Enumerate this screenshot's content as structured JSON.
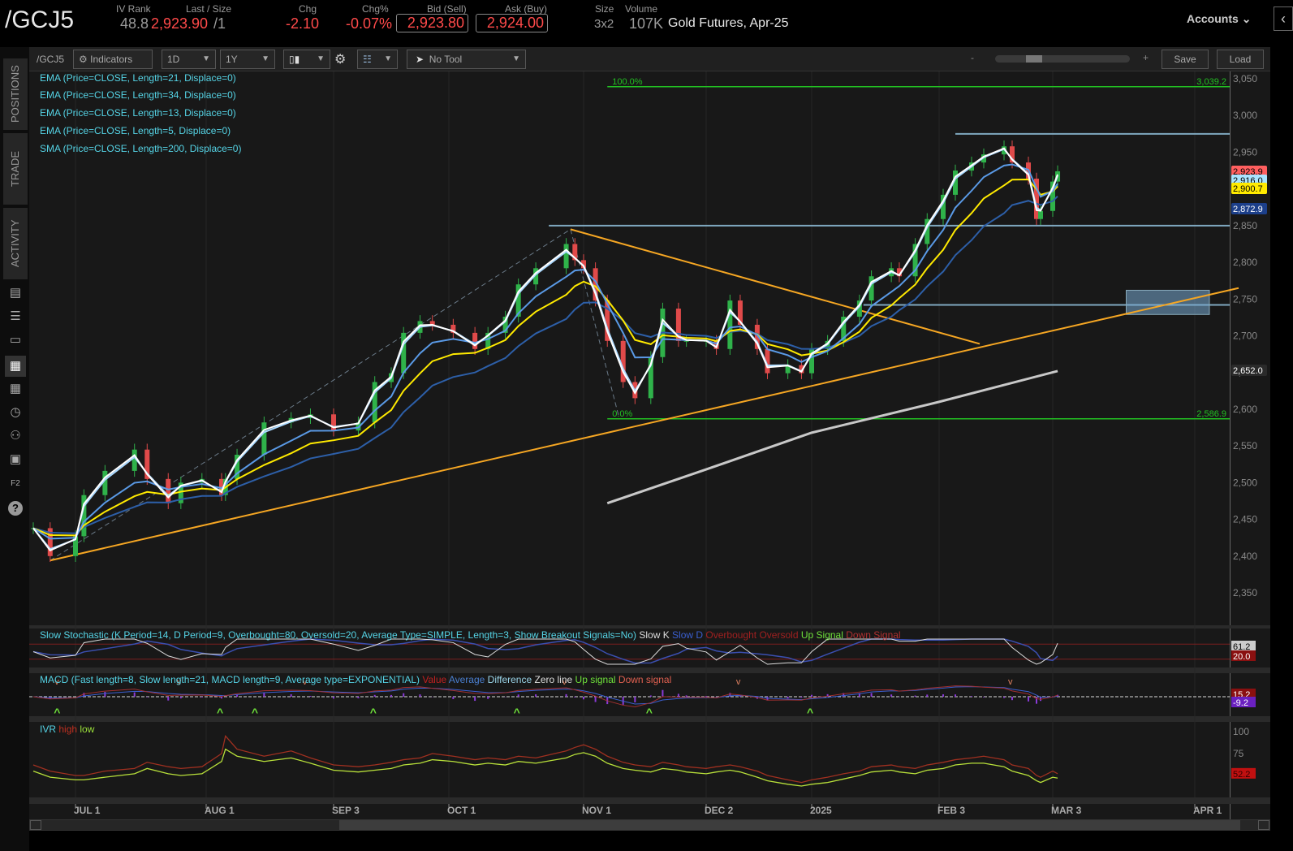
{
  "header": {
    "symbol": "/GCJ5",
    "iv_rank_label": "IV Rank",
    "iv_rank": "48.8",
    "last_label": "Last / Size",
    "last": "2,923.90",
    "size": "/1",
    "chg_label": "Chg",
    "chg": "-2.10",
    "chgpct_label": "Chg%",
    "chgpct": "-0.07%",
    "bid_label": "Bid (Sell)",
    "bid": "2,923.80",
    "ask_label": "Ask (Buy)",
    "ask": "2,924.00",
    "size_label": "Size",
    "size_val": "3x2",
    "volume_label": "Volume",
    "volume": "107K",
    "description": "Gold Futures, Apr-25",
    "accounts": "Accounts"
  },
  "toolbar": {
    "symbol": "/GCJ5",
    "indicators": "Indicators",
    "aggregation": "1D",
    "timeframe": "1Y",
    "tool": "No Tool",
    "zoom_minus": "-",
    "zoom_plus": "+",
    "save": "Save",
    "load": "Load"
  },
  "sidebar": {
    "tabs": [
      "POSITIONS",
      "TRADE",
      "ACTIVITY"
    ],
    "icons": [
      "news-icon",
      "list-icon",
      "tv-icon",
      "chart-icon",
      "grid-icon",
      "clock-icon",
      "people-icon",
      "calendar-icon",
      "function-key-icon",
      "help-icon"
    ]
  },
  "studies": [
    "EMA (Price=CLOSE, Length=21, Displace=0)",
    "EMA (Price=CLOSE, Length=34, Displace=0)",
    "EMA (Price=CLOSE, Length=13, Displace=0)",
    "EMA (Price=CLOSE, Length=5, Displace=0)",
    "SMA (Price=CLOSE, Length=200, Displace=0)"
  ],
  "stoch": {
    "label": "Slow Stochastic (K Period=14, D Period=9, Overbought=80, Oversold=20, Average Type=SIMPLE, Length=3, Show Breakout Signals=No)",
    "legend": [
      "Slow K",
      "Slow D",
      "Overbought",
      "Oversold",
      "Up Signal",
      "Down Signal"
    ],
    "badges": [
      "61.2",
      "20.0"
    ]
  },
  "macd": {
    "label": "MACD (Fast length=8, Slow length=21, MACD length=9, Average type=EXPONENTIAL)",
    "legend": [
      "Value",
      "Average",
      "Difference",
      "Zero line",
      "Up signal",
      "Down signal"
    ],
    "badges": [
      "15.2",
      "-9.2"
    ],
    "up_signal_dates": [
      "2024-06-27",
      "2024-08-05",
      "2024-08-14",
      "2024-09-13",
      "2024-10-17",
      "2024-11-18",
      "2025-01-02"
    ],
    "down_signal_dates": [
      "2024-06-27",
      "2024-07-26",
      "2024-08-27",
      "2024-10-28",
      "2024-12-12",
      "2025-02-21"
    ]
  },
  "ivr": {
    "label": "IVR",
    "legend": [
      "high",
      "low"
    ],
    "ticks": [
      100,
      75
    ],
    "badge": "52.2"
  },
  "colors": {
    "up": "#2fb24a",
    "down": "#e04a4a",
    "ema5": "#ffffff",
    "ema13": "#a9d8ff",
    "ema21": "#5a9ae6",
    "ema34": "#ffea00",
    "ema34b": "#2d5fa8",
    "sma200": "#c8c8c8",
    "trend": "#f5a623",
    "fib": "#22c022",
    "level": "#7fa8bf"
  },
  "chart_data": {
    "type": "candlestick",
    "symbol": "/GCJ5",
    "ylim": [
      2300,
      3075
    ],
    "yticks": [
      2350,
      2400,
      2450,
      2500,
      2550,
      2600,
      2650,
      2700,
      2750,
      2800,
      2850,
      2900,
      2950,
      3000,
      3050
    ],
    "ytick_labels": [
      "2,350",
      "2,400",
      "2,450",
      "2,500",
      "2,550",
      "2,600",
      "2,650",
      "2,700",
      "2,750",
      "2,800",
      "2,850",
      "2,900",
      "2,950",
      "3,000",
      "3,050"
    ],
    "xticks": [
      {
        "date": "2024-07-01",
        "label": "JUL 1"
      },
      {
        "date": "2024-08-01",
        "label": "AUG 1"
      },
      {
        "date": "2024-09-03",
        "label": "SEP 3"
      },
      {
        "date": "2024-10-01",
        "label": "OCT 1"
      },
      {
        "date": "2024-11-01",
        "label": "NOV 1"
      },
      {
        "date": "2024-12-02",
        "label": "DEC 2"
      },
      {
        "date": "2025-01-02",
        "label": "2025"
      },
      {
        "date": "2025-02-03",
        "label": "FEB 3"
      },
      {
        "date": "2025-03-03",
        "label": "MAR 3"
      },
      {
        "date": "2025-04-01",
        "label": "APR 1"
      }
    ],
    "dates": [
      "2024-06-21",
      "2024-06-25",
      "2024-07-01",
      "2024-07-03",
      "2024-07-08",
      "2024-07-15",
      "2024-07-18",
      "2024-07-23",
      "2024-07-26",
      "2024-07-31",
      "2024-08-05",
      "2024-08-06",
      "2024-08-09",
      "2024-08-16",
      "2024-08-23",
      "2024-08-28",
      "2024-09-03",
      "2024-09-09",
      "2024-09-13",
      "2024-09-17",
      "2024-09-20",
      "2024-09-24",
      "2024-09-27",
      "2024-10-02",
      "2024-10-07",
      "2024-10-10",
      "2024-10-14",
      "2024-10-17",
      "2024-10-21",
      "2024-10-28",
      "2024-10-30",
      "2024-11-01",
      "2024-11-04",
      "2024-11-07",
      "2024-11-11",
      "2024-11-14",
      "2024-11-18",
      "2024-11-21",
      "2024-11-25",
      "2024-11-27",
      "2024-12-02",
      "2024-12-05",
      "2024-12-09",
      "2024-12-12",
      "2024-12-17",
      "2024-12-20",
      "2024-12-26",
      "2024-12-30",
      "2025-01-02",
      "2025-01-06",
      "2025-01-10",
      "2025-01-14",
      "2025-01-17",
      "2025-01-22",
      "2025-01-24",
      "2025-01-28",
      "2025-01-31",
      "2025-02-04",
      "2025-02-07",
      "2025-02-11",
      "2025-02-14",
      "2025-02-19",
      "2025-02-21",
      "2025-02-25",
      "2025-02-27",
      "2025-02-28",
      "2025-03-03",
      "2025-03-04"
    ],
    "close": [
      2438,
      2400,
      2427,
      2483,
      2516,
      2545,
      2505,
      2472,
      2500,
      2505,
      2483,
      2505,
      2538,
      2582,
      2588,
      2593,
      2571,
      2582,
      2637,
      2649,
      2704,
      2720,
      2715,
      2704,
      2682,
      2704,
      2726,
      2770,
      2792,
      2825,
      2803,
      2792,
      2748,
      2693,
      2637,
      2615,
      2671,
      2737,
      2693,
      2693,
      2693,
      2682,
      2748,
      2715,
      2682,
      2649,
      2660,
      2649,
      2682,
      2693,
      2726,
      2748,
      2781,
      2792,
      2781,
      2825,
      2859,
      2892,
      2925,
      2936,
      2947,
      2958,
      2936,
      2914,
      2859,
      2870,
      2910,
      2924
    ],
    "sma200": [
      {
        "date": "2024-11-07",
        "value": 2472
      },
      {
        "date": "2024-12-02",
        "value": 2518
      },
      {
        "date": "2025-01-02",
        "value": 2568
      },
      {
        "date": "2025-02-03",
        "value": 2610
      },
      {
        "date": "2025-03-04",
        "value": 2652
      }
    ],
    "price_badges": [
      {
        "label": "2,923.9",
        "color": "#ff5f5f"
      },
      {
        "label": "2,916.0",
        "color": "#a9e4ff"
      },
      {
        "label": "2,900.7",
        "color": "#ffea00"
      },
      {
        "label": "2,872.9",
        "color": "#1c3f8a"
      },
      {
        "label": "2,652.0",
        "color": "#2a2a2a"
      }
    ],
    "fibonacci": {
      "high": {
        "level": "100.0%",
        "price": 3039.2,
        "price_label": "3,039.2"
      },
      "low": {
        "level": "0.0%",
        "price": 2586.9,
        "price_label": "2,586.9"
      },
      "start_date": "2024-11-07"
    },
    "horizontal_levels": [
      {
        "price": 2975,
        "from": "2025-02-07"
      },
      {
        "price": 2850,
        "from": "2024-10-24"
      },
      {
        "price": 2742,
        "from": "2025-01-15"
      }
    ],
    "trendlines": [
      {
        "from": {
          "date": "2024-06-25",
          "price": 2394
        },
        "to": {
          "date": "2025-04-10",
          "price": 2765
        }
      },
      {
        "from": {
          "date": "2024-10-29",
          "price": 2845
        },
        "to": {
          "date": "2025-02-13",
          "price": 2689
        }
      }
    ],
    "dashed_lines": [
      {
        "from": {
          "date": "2024-06-25",
          "price": 2394
        },
        "to": {
          "date": "2024-10-29",
          "price": 2845
        }
      },
      {
        "from": {
          "date": "2024-10-29",
          "price": 2845
        },
        "to": {
          "date": "2024-11-10",
          "price": 2588
        }
      }
    ],
    "zone": {
      "from": "2025-03-18",
      "to": "2025-04-04",
      "top": 2762,
      "bottom": 2729
    },
    "ivr_high": [
      62,
      55,
      50,
      50,
      55,
      58,
      65,
      60,
      58,
      60,
      75,
      95,
      80,
      72,
      78,
      70,
      62,
      60,
      62,
      65,
      68,
      70,
      75,
      72,
      68,
      70,
      68,
      72,
      70,
      78,
      82,
      85,
      80,
      72,
      65,
      62,
      60,
      65,
      62,
      60,
      58,
      60,
      62,
      60,
      55,
      50,
      45,
      42,
      45,
      48,
      52,
      55,
      60,
      62,
      60,
      58,
      62,
      65,
      68,
      70,
      72,
      68,
      62,
      58,
      50,
      48,
      55,
      52
    ],
    "ivr_low": [
      55,
      48,
      45,
      45,
      48,
      52,
      58,
      52,
      50,
      52,
      66,
      80,
      72,
      66,
      70,
      64,
      56,
      54,
      56,
      58,
      62,
      64,
      68,
      66,
      62,
      64,
      62,
      66,
      64,
      70,
      74,
      76,
      72,
      64,
      58,
      56,
      54,
      58,
      56,
      54,
      52,
      54,
      56,
      54,
      48,
      44,
      40,
      38,
      40,
      42,
      46,
      50,
      54,
      56,
      54,
      52,
      56,
      58,
      62,
      64,
      64,
      60,
      55,
      50,
      44,
      42,
      48,
      47
    ]
  }
}
